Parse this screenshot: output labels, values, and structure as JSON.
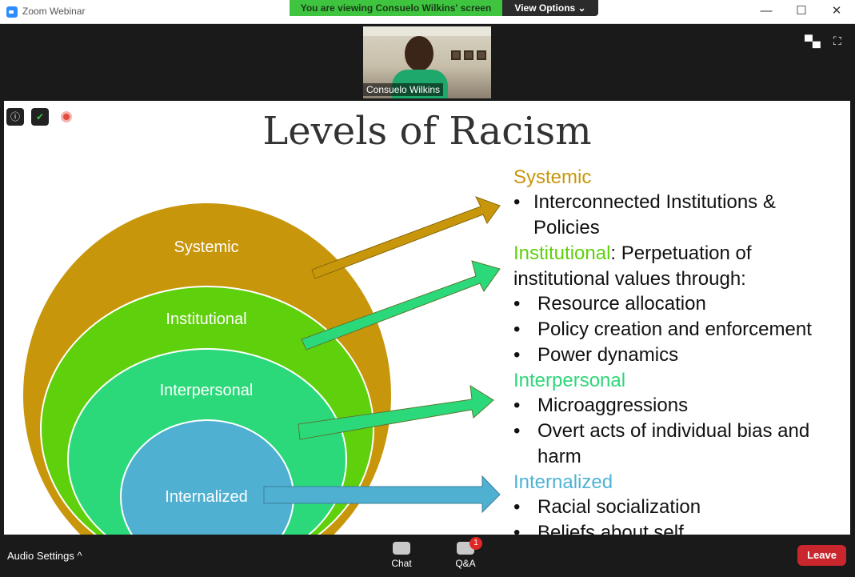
{
  "window": {
    "title": "Zoom Webinar",
    "minimize": "—",
    "maximize": "☐",
    "close": "✕"
  },
  "banner": {
    "viewing_text": "You are viewing Consuelo Wilkins' screen",
    "view_options": "View Options ⌄"
  },
  "participant": {
    "name": "Consuelo Wilkins"
  },
  "slide": {
    "title": "Levels of Racism",
    "circles": [
      "Systemic",
      "Institutional",
      "Interpersonal",
      "Internalized"
    ],
    "sections": [
      {
        "heading": "Systemic",
        "heading_color": "#c8960b",
        "suffix": "",
        "bullets": [
          "Interconnected Institutions &",
          "Policies"
        ]
      },
      {
        "heading": "Institutional",
        "heading_color": "#5fd00c",
        "suffix": ": Perpetuation of",
        "line2": "institutional values through:",
        "bullets": [
          "Resource allocation",
          "Policy creation and enforcement",
          "Power dynamics"
        ]
      },
      {
        "heading": "Interpersonal",
        "heading_color": "#2fd67a",
        "suffix": "",
        "bullets": [
          "Microaggressions",
          "Overt acts of individual bias and",
          "harm"
        ]
      },
      {
        "heading": "Internalized",
        "heading_color": "#4fb3d4",
        "suffix": "",
        "bullets": [
          "Racial socialization",
          "Beliefs about self"
        ]
      }
    ]
  },
  "colors": {
    "systemic": "#c8960b",
    "institutional": "#5fd00c",
    "interpersonal": "#2bd97a",
    "internalized": "#4fb0d1",
    "leave": "#c9272d"
  },
  "bottom": {
    "audio_settings": "Audio Settings  ^",
    "chat": "Chat",
    "qa": "Q&A",
    "qa_badge": "1",
    "leave": "Leave"
  }
}
